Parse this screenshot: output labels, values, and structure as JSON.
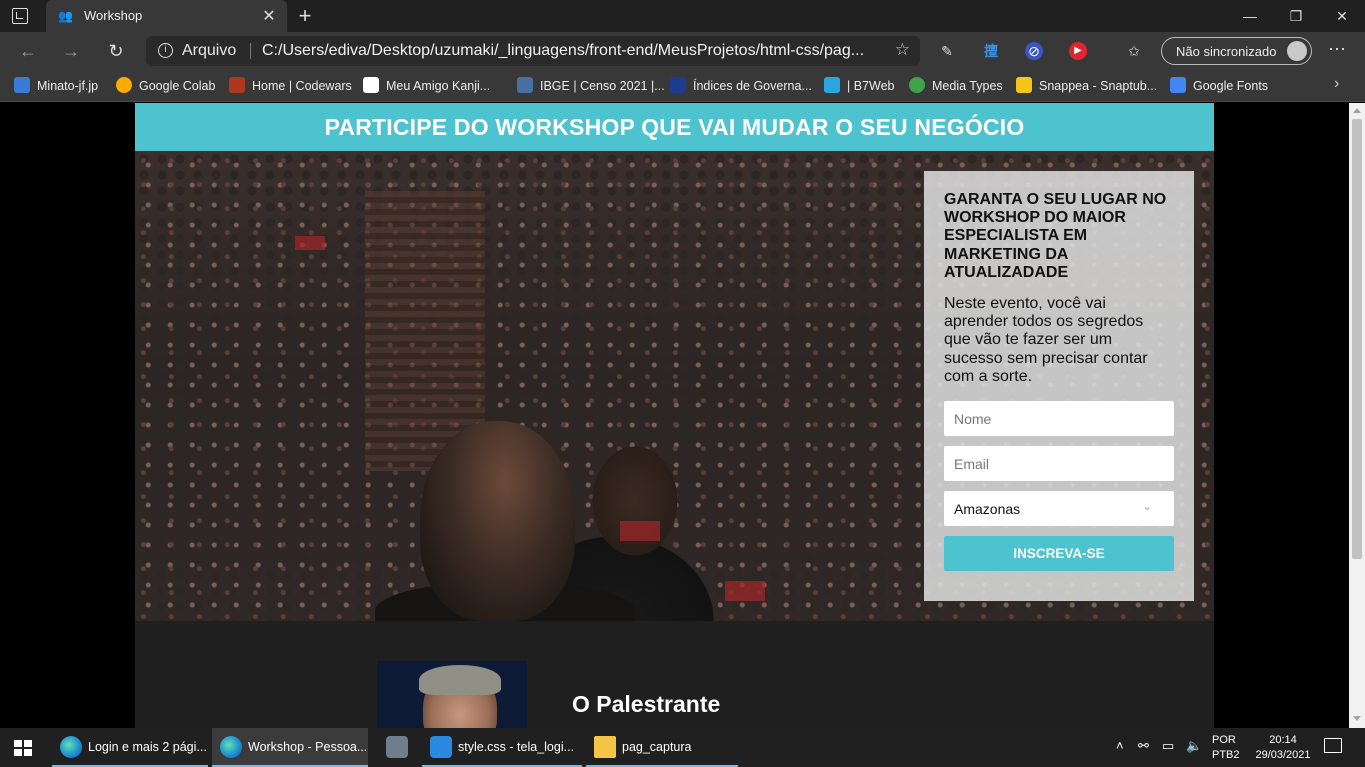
{
  "browser": {
    "tab_title": "Workshop",
    "address_label": "Arquivo",
    "url": "C:/Users/ediva/Desktop/uzumaki/_linguagens/front-end/MeusProjetos/html-css/pag...",
    "sync_label": "Não sincronizado",
    "bookmarks": [
      {
        "label": "Minato-jf.jp",
        "color": "#3a7bd5"
      },
      {
        "label": "Google Colab",
        "color": "#f9ab00"
      },
      {
        "label": "Home | Codewars",
        "color": "#b1361e"
      },
      {
        "label": "Meu Amigo Kanji...",
        "color": "#ffffff"
      },
      {
        "label": "IBGE | Censo 2021 |...",
        "color": "#4a6fa5"
      },
      {
        "label": "Índices de Governa...",
        "color": "#1d3c8f"
      },
      {
        "label": "| B7Web",
        "color": "#2aa7e0"
      },
      {
        "label": "Media Types",
        "color": "#3fa34d"
      },
      {
        "label": "Snappea - Snaptub...",
        "color": "#f5c518"
      },
      {
        "label": "Google Fonts",
        "color": "#4285f4"
      }
    ]
  },
  "page": {
    "banner": "PARTICIPE DO WORKSHOP QUE VAI MUDAR O SEU NEGÓCIO",
    "form": {
      "title": "GARANTA O SEU LUGAR NO WORKSHOP DO MAIOR ESPECIALISTA EM MARKETING DA ATUALIZADADE",
      "description": "Neste evento, você vai aprender todos os segredos que vão te fazer ser um sucesso sem precisar contar com a sorte.",
      "name_placeholder": "Nome",
      "email_placeholder": "Email",
      "state_selected": "Amazonas",
      "submit_label": "INSCREVA-SE"
    },
    "speaker_heading": "O Palestrante"
  },
  "taskbar": {
    "items": [
      {
        "label": "Login e mais 2 pági..."
      },
      {
        "label": "Workshop - Pessoa..."
      },
      {
        "label": ""
      },
      {
        "label": "style.css - tela_logi..."
      },
      {
        "label": "pag_captura"
      }
    ],
    "lang": "POR",
    "layout": "PTB2",
    "time": "20:14",
    "date": "29/03/2021"
  },
  "colors": {
    "accent": "#4ec3d0",
    "browser_dark": "#383838"
  }
}
